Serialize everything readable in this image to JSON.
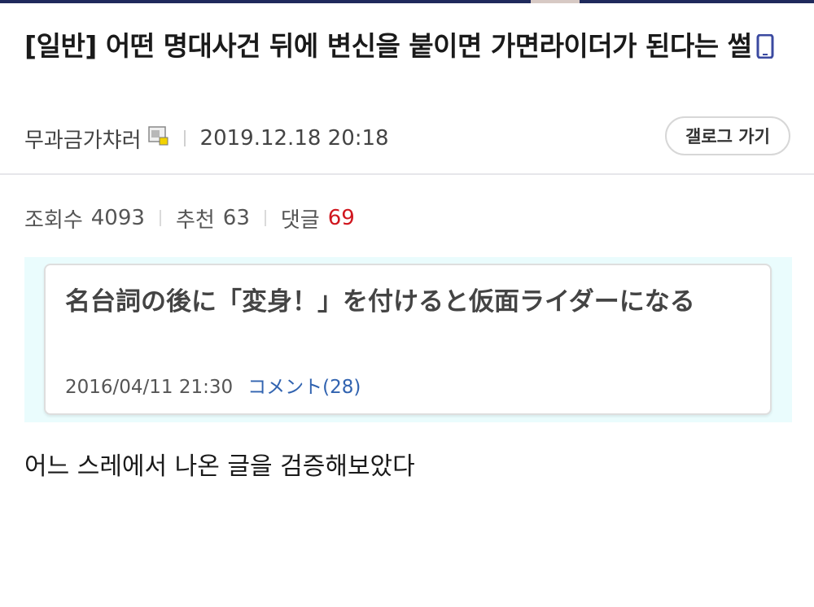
{
  "post": {
    "title": "[일반] 어떤 명대사건 뒤에 변신을 붙이면 가면라이더가 된다는 썰",
    "title_icon": "mobile-phone-icon",
    "author": "무과금가챠러",
    "author_icon": "member-grade-icon",
    "datetime": "2019.12.18 20:18",
    "gallery_button": "갤로그 가기",
    "stats": {
      "views_label": "조회수",
      "views": "4093",
      "recommend_label": "추천",
      "recommend": "63",
      "comments_label": "댓글",
      "comments": "69"
    },
    "embed": {
      "title": "名台詞の後に「変身！」を付けると仮面ライダーになる",
      "date": "2016/04/11 21:30",
      "comments_link": "コメント(28)"
    },
    "body": "어느 스레에서 나온 글을 검증해보았다"
  },
  "colors": {
    "accent_red": "#d0161e",
    "link_blue": "#3163b0",
    "embed_bg": "#eafcfd",
    "phone_icon": "#3b4aa0"
  }
}
